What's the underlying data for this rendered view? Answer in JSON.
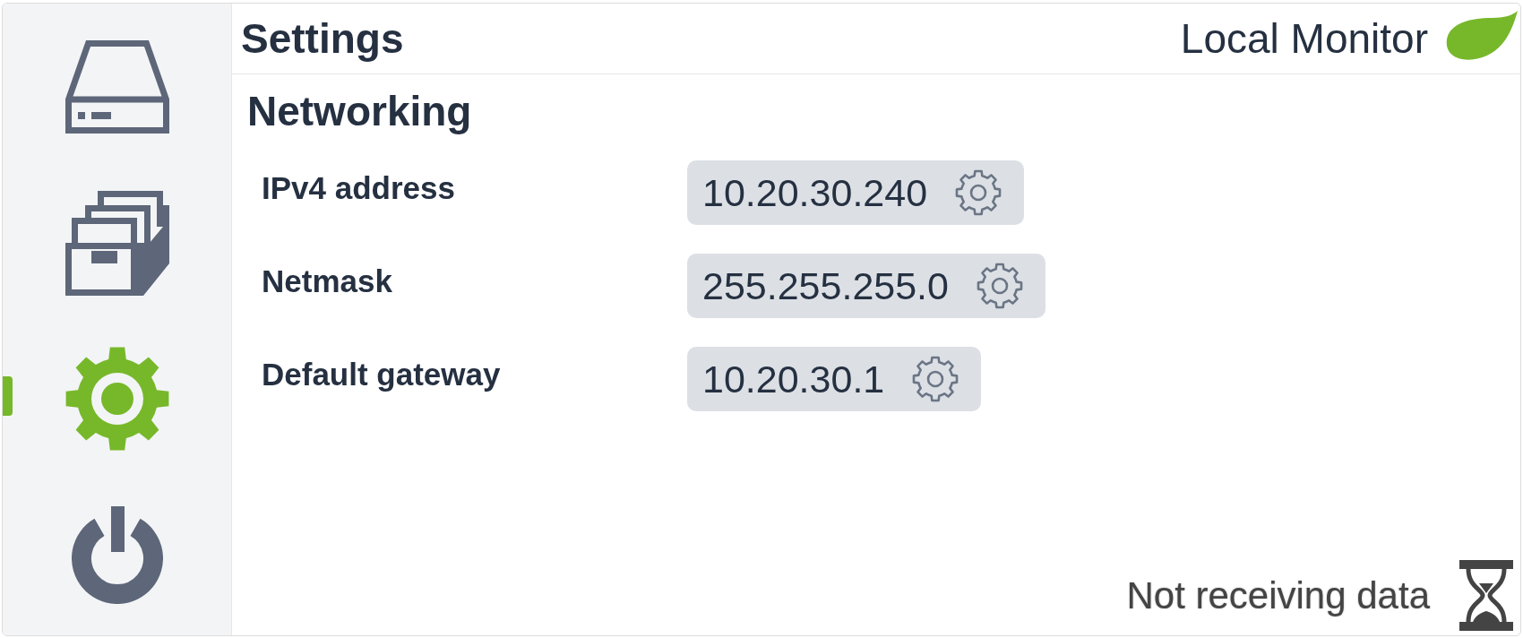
{
  "sidebar": {
    "items": [
      {
        "kind": "drive",
        "selected": false
      },
      {
        "kind": "archive",
        "selected": false
      },
      {
        "kind": "settings",
        "selected": true
      },
      {
        "kind": "power",
        "selected": false
      }
    ]
  },
  "header": {
    "title": "Settings",
    "brand": "Local Monitor"
  },
  "section": {
    "title": "Networking",
    "fields": [
      {
        "label": "IPv4 address",
        "value": "10.20.30.240"
      },
      {
        "label": "Netmask",
        "value": "255.255.255.0"
      },
      {
        "label": "Default gateway",
        "value": "10.20.30.1"
      }
    ]
  },
  "status": {
    "text": "Not receiving data"
  }
}
